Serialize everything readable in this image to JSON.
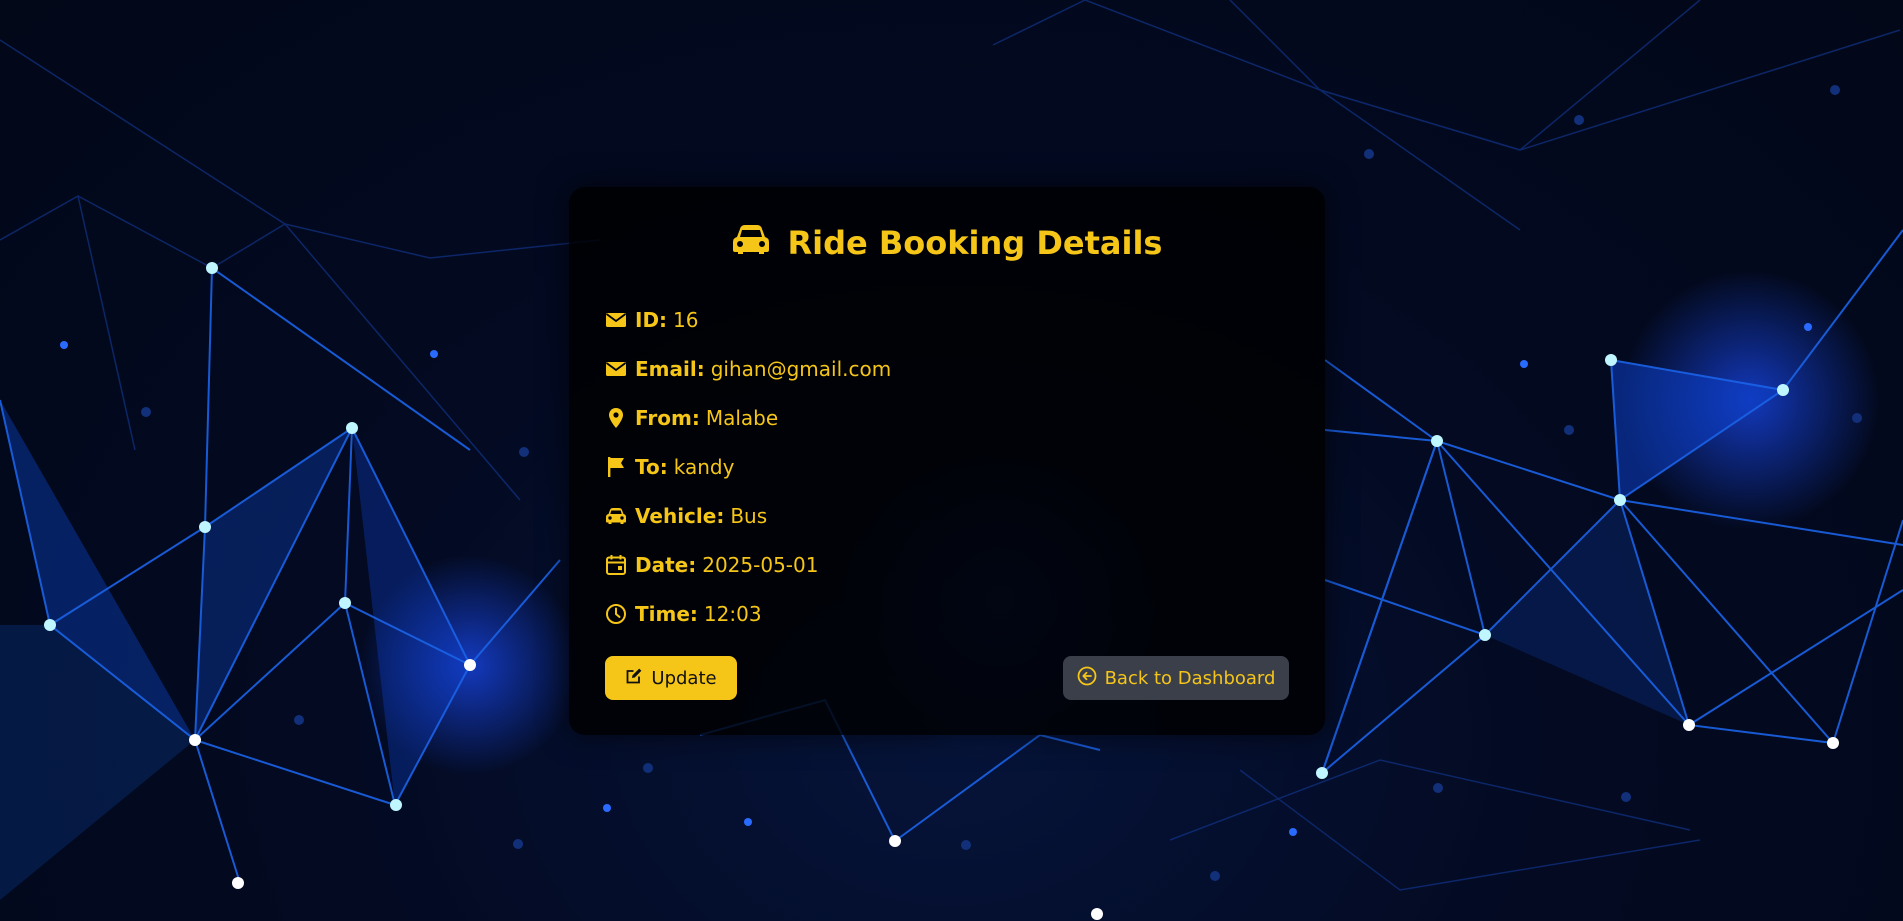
{
  "card": {
    "title": "Ride Booking Details",
    "title_icon": "car-icon"
  },
  "details": [
    {
      "icon": "envelope-icon",
      "label": "ID:",
      "value": "16"
    },
    {
      "icon": "envelope-icon",
      "label": "Email:",
      "value": "gihan@gmail.com"
    },
    {
      "icon": "map-pin-icon",
      "label": "From:",
      "value": "Malabe"
    },
    {
      "icon": "flag-icon",
      "label": "To:",
      "value": "kandy"
    },
    {
      "icon": "car-icon",
      "label": "Vehicle:",
      "value": "Bus"
    },
    {
      "icon": "calendar-icon",
      "label": "Date:",
      "value": "2025-05-01"
    },
    {
      "icon": "clock-icon",
      "label": "Time:",
      "value": "12:03"
    }
  ],
  "actions": {
    "update_label": "Update",
    "update_icon": "edit-icon",
    "back_label": "Back to Dashboard",
    "back_icon": "arrow-left-circle-icon"
  },
  "colors": {
    "accent": "#f5c518",
    "card_bg": "#000000",
    "back_button_bg": "#3a3f4a",
    "background": "#020818"
  }
}
